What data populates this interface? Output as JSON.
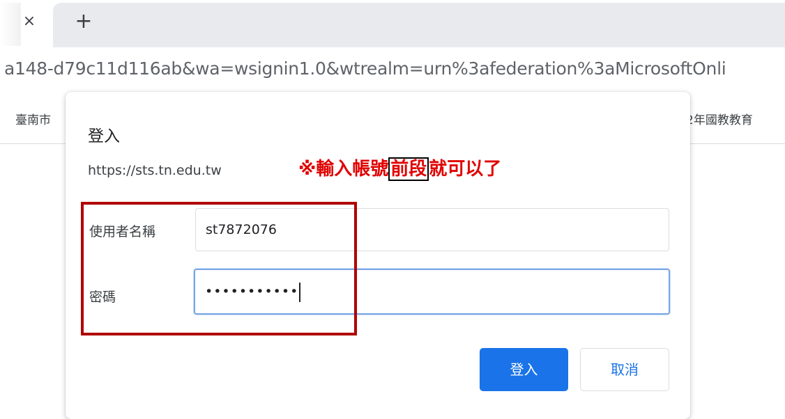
{
  "browser": {
    "tab": {
      "close_glyph": "×"
    },
    "new_tab_glyph": "+",
    "url_text": "a148-d79c11d116ab&wa=wsignin1.0&wtrealm=urn%3afederation%3aMicrosoftOnli",
    "bookmarks": {
      "left_text": "臺南市",
      "right_text": "2年國教教育"
    }
  },
  "dialog": {
    "title": "登入",
    "origin": "https://sts.tn.edu.tw",
    "note": {
      "prefix": "※輸入帳號",
      "boxed": "前段",
      "suffix": "就可以了",
      "color": "#e00000"
    },
    "username": {
      "label": "使用者名稱",
      "value": "st7872076"
    },
    "password": {
      "label": "密碼",
      "masked_value": "•••••••••••"
    },
    "buttons": {
      "sign_in": "登入",
      "cancel": "取消"
    },
    "highlight_color": "#b00000",
    "accent_color": "#1a73e8"
  }
}
